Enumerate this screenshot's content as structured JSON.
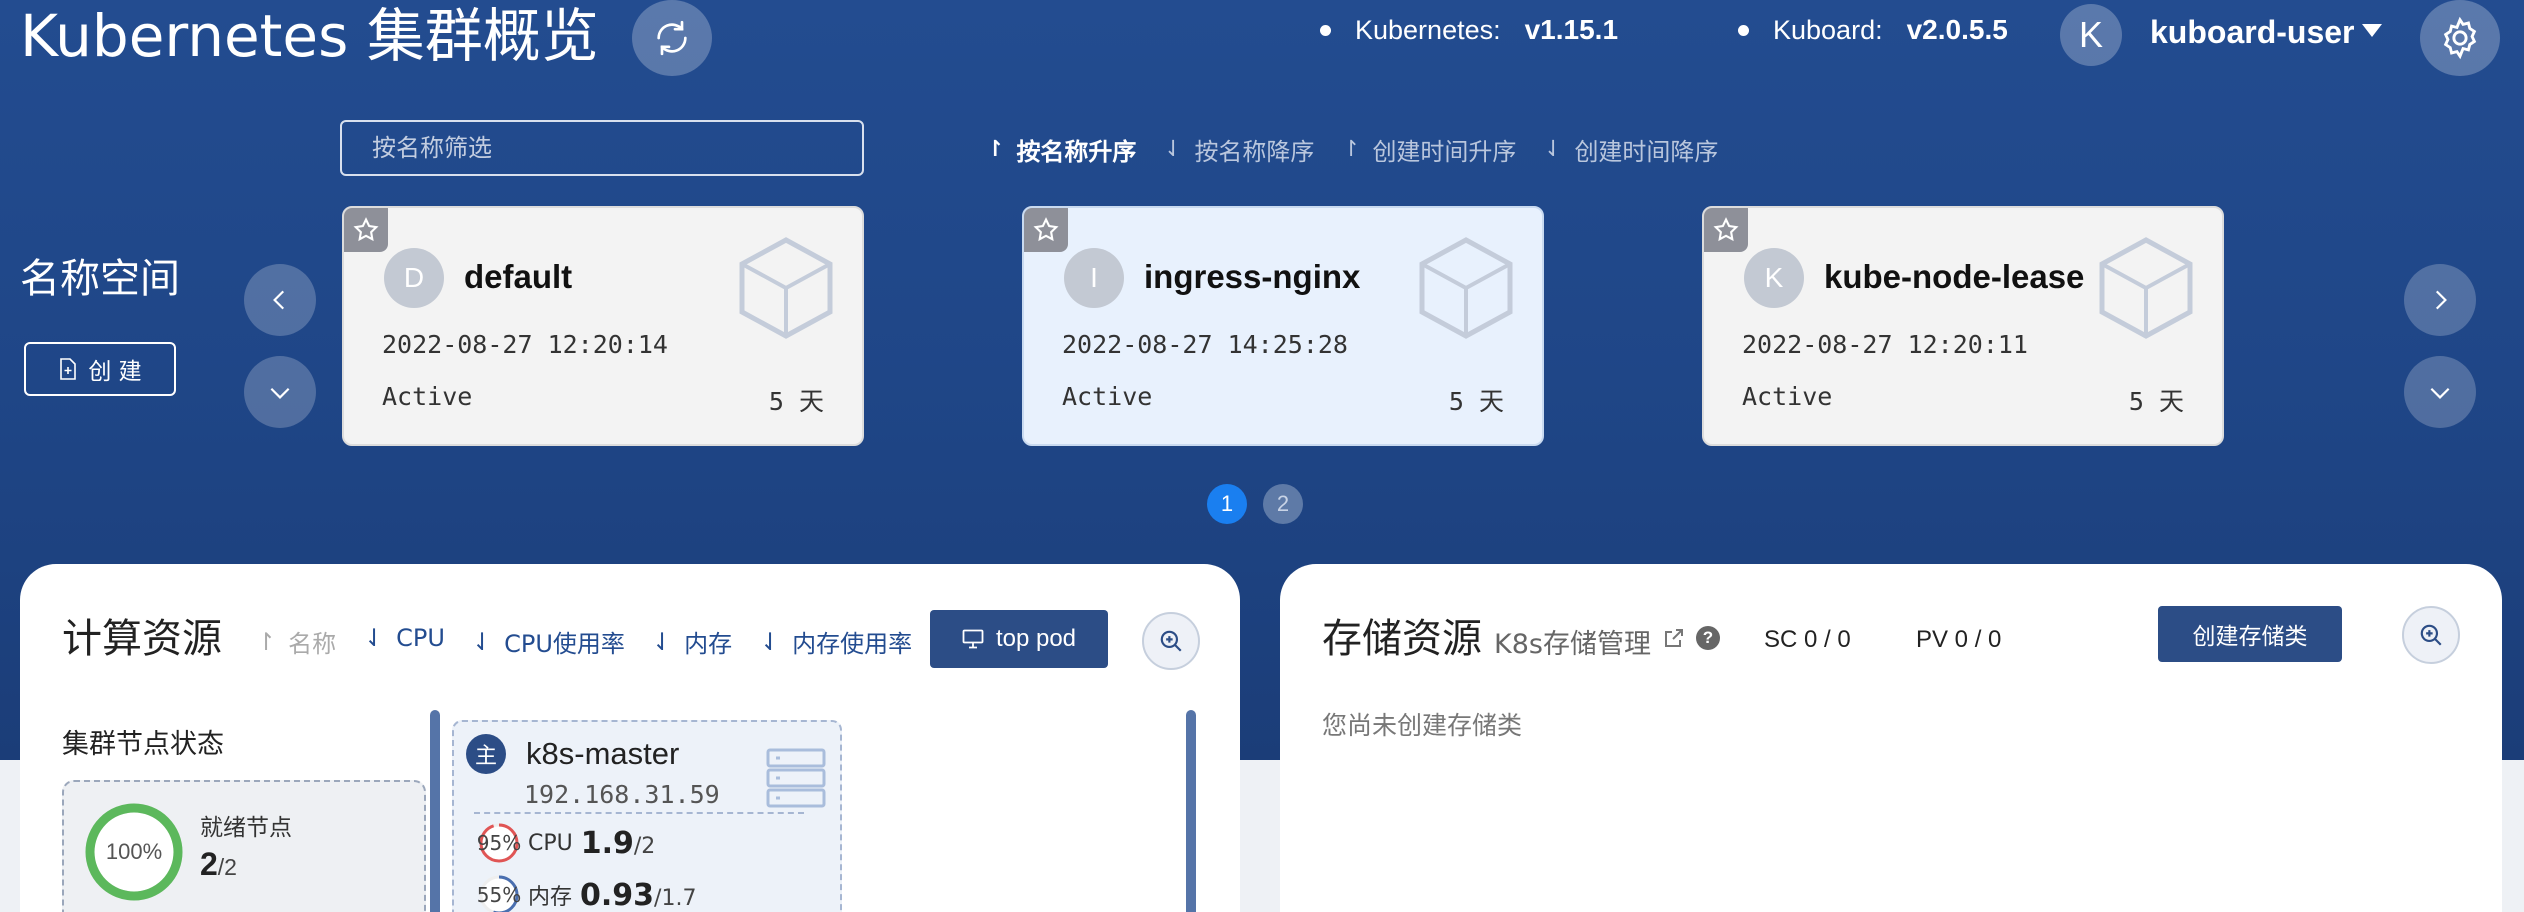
{
  "header": {
    "title": "Kubernetes 集群概览",
    "k8s_label": "Kubernetes:",
    "k8s_version": "v1.15.1",
    "kuboard_label": "Kuboard:",
    "kuboard_version": "v2.0.5.5",
    "user_initial": "K",
    "user_name": "kuboard-user"
  },
  "filter": {
    "placeholder": "按名称筛选"
  },
  "sort_options": [
    {
      "label": "按名称升序",
      "active": true
    },
    {
      "label": "按名称降序",
      "active": false
    },
    {
      "label": "创建时间升序",
      "active": false
    },
    {
      "label": "创建时间降序",
      "active": false
    }
  ],
  "namespaces": {
    "label": "名称空间",
    "create_label": "创 建",
    "cards": [
      {
        "initial": "D",
        "name": "default",
        "created": "2022-08-27 12:20:14",
        "status": "Active",
        "age": "5 天"
      },
      {
        "initial": "I",
        "name": "ingress-nginx",
        "created": "2022-08-27 14:25:28",
        "status": "Active",
        "age": "5 天"
      },
      {
        "initial": "K",
        "name": "kube-node-lease",
        "created": "2022-08-27 12:20:11",
        "status": "Active",
        "age": "5 天"
      }
    ],
    "pages": [
      "1",
      "2"
    ],
    "current_page": 1
  },
  "compute": {
    "title": "计算资源",
    "sort_labels": [
      "名称",
      "CPU",
      "CPU使用率",
      "内存",
      "内存使用率"
    ],
    "top_pod_label": "top pod",
    "cluster_status_title": "集群节点状态",
    "ready_percent_text": "100%",
    "ready_percent": 100,
    "ready_label": "就绪节点",
    "ready_count": "2",
    "ready_total": "/2",
    "node": {
      "badge": "主",
      "name": "k8s-master",
      "ip": "192.168.31.59",
      "cpu_percent_text": "95%",
      "cpu_percent": 95,
      "cpu_label": "CPU",
      "cpu_value": "1.9",
      "cpu_total": "/2",
      "mem_percent_text": "55%",
      "mem_percent": 55,
      "mem_label": "内存",
      "mem_value": "0.93",
      "mem_total": "/1.7"
    }
  },
  "storage": {
    "title": "存储资源",
    "subtitle": "K8s存储管理",
    "sc_count": "SC 0 / 0",
    "pv_count": "PV 0 / 0",
    "create_label": "创建存储类",
    "empty_text": "您尚未创建存储类"
  },
  "colors": {
    "hero": "#234c90",
    "primary_button": "#2c4d86",
    "ready_ring": "#5cb85c",
    "cpu_ring": "#e05555",
    "mem_ring": "#4a6fb0",
    "active_page": "#1a7ff0"
  }
}
